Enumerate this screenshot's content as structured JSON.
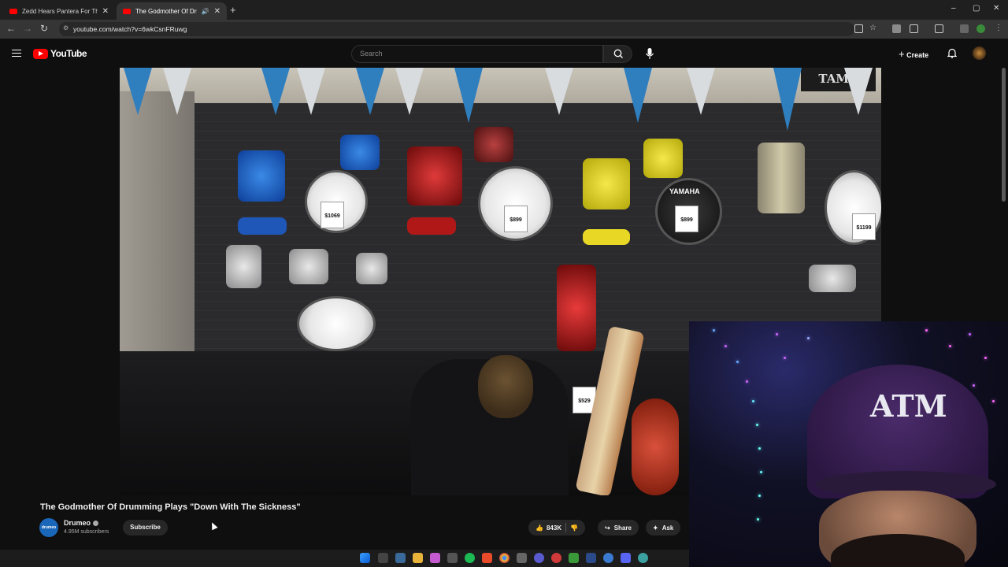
{
  "browser": {
    "tabs": [
      {
        "title": "Zedd Hears Pantera For The Fi",
        "close": "✕"
      },
      {
        "title": "The Godmother Of Drummi",
        "close": "✕"
      }
    ],
    "new_tab": "+",
    "window_controls": [
      "–",
      "▢",
      "✕"
    ],
    "nav": {
      "back": "←",
      "forward": "→",
      "reload": "↻"
    },
    "url": "youtube.com/watch?v=6wkCsnFRuwg"
  },
  "youtube": {
    "logo_text": "YouTube",
    "search": {
      "placeholder": "Search"
    },
    "create_label": "Create",
    "create_icon": "+",
    "bell_icon": "🔔"
  },
  "video": {
    "price_tags": [
      "$1069",
      "$899",
      "$899",
      "$1199",
      "$529"
    ],
    "brand_signs": [
      "TAMA",
      "YAMAHA"
    ]
  },
  "webcam": {
    "hat_logo": "ATM"
  },
  "info": {
    "title": "The Godmother Of Drumming Plays \"Down With The Sickness\"",
    "channel": {
      "avatar_text": "drumeo",
      "name": "Drumeo",
      "subscribers": "4.95M subscribers",
      "subscribe_label": "Subscribe"
    },
    "actions": {
      "likes": "843K",
      "share": "Share",
      "ask": "Ask"
    }
  }
}
